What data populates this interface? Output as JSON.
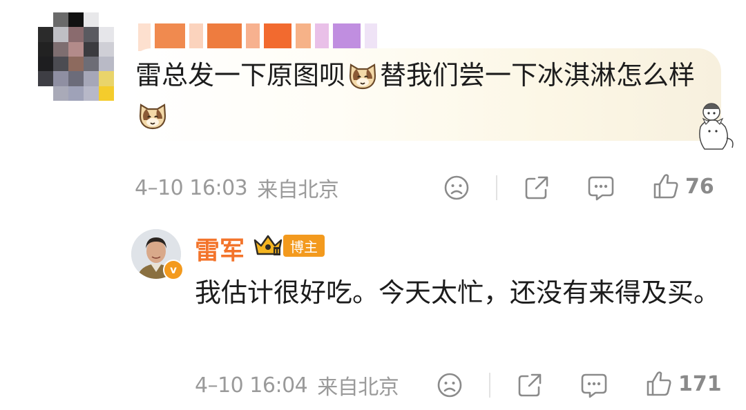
{
  "comment": {
    "text_part1": "雷总发一下原图呗",
    "text_part2": "替我们尝一下冰淇淋怎么样",
    "emoji_1": "cat-face-icon",
    "emoji_2": "cat-face-icon",
    "time": "4–10 16:03",
    "source": "来自北京",
    "like_count": "76"
  },
  "reply": {
    "author": "雷军",
    "badge_label": "博主",
    "verified_mark": "v",
    "text": "我估计很好吃。今天太忙，还没有来得及买。",
    "time": "4–10 16:04",
    "source": "来自北京",
    "like_count": "171"
  },
  "colors": {
    "author_name": "#f3742b",
    "badge_bg": "#f39a1e",
    "meta_text": "#9a9a9a"
  },
  "icons": [
    "sad-face-icon",
    "share-icon",
    "comment-icon",
    "thumbs-up-icon"
  ]
}
